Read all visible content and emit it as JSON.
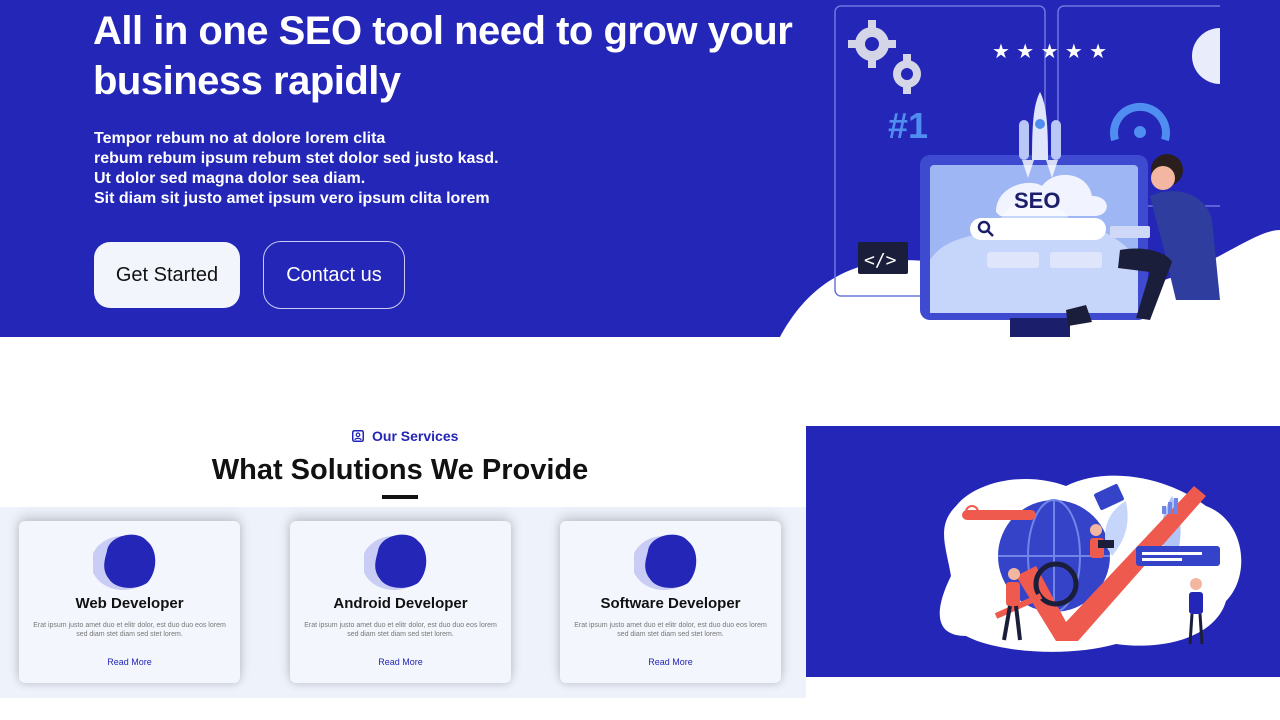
{
  "hero": {
    "title": "All in one SEO tool need to grow your business rapidly",
    "lines": [
      "Tempor rebum no at dolore lorem clita",
      "rebum rebum ipsum rebum stet dolor sed justo kasd.",
      "Ut dolor sed magna dolor sea diam.",
      "Sit diam sit justo amet ipsum vero ipsum clita lorem"
    ],
    "primary_button": "Get Started",
    "secondary_button": "Contact us",
    "illustration": {
      "seo_label": "SEO",
      "rank_label": "#1",
      "code_label": "</>",
      "stars": "★ ★ ★ ★ ★"
    }
  },
  "services": {
    "label": "Our Services",
    "heading": "What Solutions We Provide",
    "cards": [
      {
        "title": "Web Developer",
        "desc": "Erat ipsum justo amet duo et elitr dolor, est duo duo eos lorem sed diam stet diam sed stet lorem.",
        "link": "Read More"
      },
      {
        "title": "Android Developer",
        "desc": "Erat ipsum justo amet duo et elitr dolor, est duo duo eos lorem sed diam stet diam sed stet lorem.",
        "link": "Read More"
      },
      {
        "title": "Software Developer",
        "desc": "Erat ipsum justo amet duo et elitr dolor, est duo duo eos lorem sed diam stet diam sed stet lorem.",
        "link": "Read More"
      }
    ]
  },
  "colors": {
    "brand_blue": "#2326b6",
    "light_band": "#eef2fb",
    "accent_red": "#ef5a4f"
  },
  "icons": [
    "gear-icon",
    "star-icon",
    "rocket-icon",
    "search-icon",
    "code-icon",
    "user-badge-icon",
    "blob-icon"
  ]
}
